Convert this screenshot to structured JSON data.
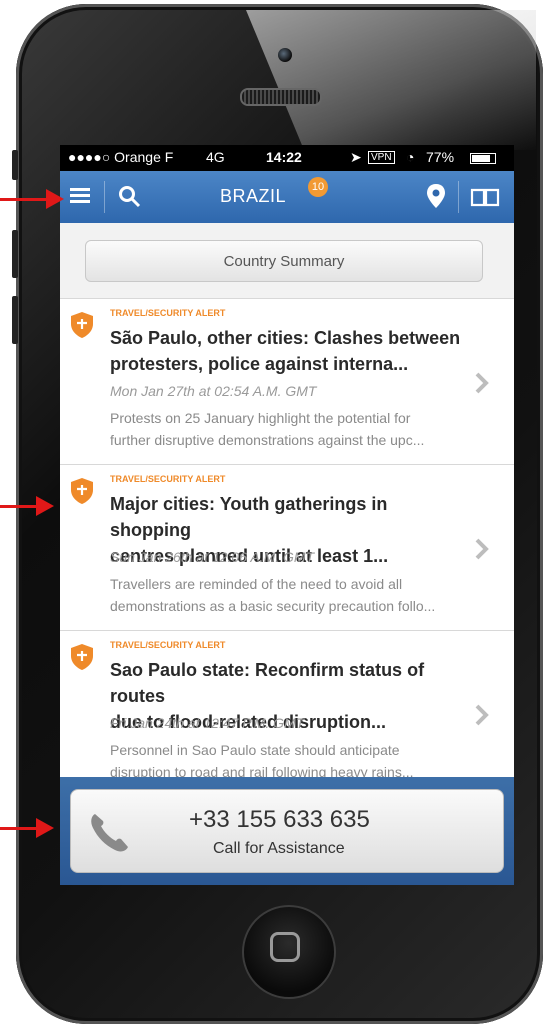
{
  "status_bar": {
    "carrier": "●●●●○ Orange F",
    "network": "4G",
    "time": "14:22",
    "vpn": "VPN",
    "battery": "77%"
  },
  "nav": {
    "title": "BRAZIL",
    "badge": "10",
    "icons": [
      "menu-icon",
      "search-icon",
      "location-pin-icon",
      "book-icon"
    ]
  },
  "summary_button": "Country Summary",
  "alerts": [
    {
      "category": "TRAVEL/SECURITY ALERT",
      "title_line1": "São Paulo, other cities: Clashes between",
      "title_line2": "protesters, police against interna...",
      "date": "Mon Jan 27th at 02:54 A.M. GMT",
      "body_line1": "Protests on 25 January highlight the potential for",
      "body_line2": "further disruptive demonstrations against the upc..."
    },
    {
      "category": "TRAVEL/SECURITY ALERT",
      "title_line1": "Major cities: Youth gatherings in shopping",
      "title_line2": "centres planned until at least 1...",
      "date": "Sun Jan 26th at 12:06 A.M. GMT",
      "body_line1": "Travellers are reminded of the need to avoid all",
      "body_line2": "demonstrations as a basic security precaution follo..."
    },
    {
      "category": "TRAVEL/SECURITY ALERT",
      "title_line1": "Sao Paulo state: Reconfirm status of routes",
      "title_line2": "due to flood-related disruption...",
      "date": "Fri Jan 24th at 12:47 P.M. GMT",
      "body_line1": "Personnel in Sao Paulo state should anticipate",
      "body_line2": "disruption to road and rail following heavy rains..."
    }
  ],
  "call": {
    "number": "+33 155 633 635",
    "label": "Call for Assistance"
  },
  "colors": {
    "nav_blue": "#2e67ad",
    "accent_orange": "#ef8a2a",
    "arrow_red": "#e01818"
  }
}
